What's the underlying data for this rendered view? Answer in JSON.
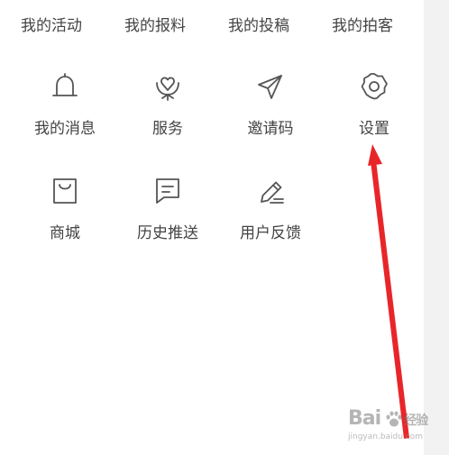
{
  "top_links": [
    {
      "label": "我的活动"
    },
    {
      "label": "我的报料"
    },
    {
      "label": "我的投稿"
    },
    {
      "label": "我的拍客"
    }
  ],
  "grid_items": [
    {
      "label": "我的消息",
      "icon": "bell-icon"
    },
    {
      "label": "服务",
      "icon": "heart-hand-icon"
    },
    {
      "label": "邀请码",
      "icon": "send-icon"
    },
    {
      "label": "设置",
      "icon": "gear-icon"
    },
    {
      "label": "商城",
      "icon": "shopping-bag-icon"
    },
    {
      "label": "历史推送",
      "icon": "message-icon"
    },
    {
      "label": "用户反馈",
      "icon": "pencil-icon"
    }
  ],
  "watermark": {
    "logo_text_1": "Bai",
    "logo_text_2": "经验",
    "url": "jingyan.baidu.com"
  },
  "colors": {
    "text": "#444444",
    "icon_stroke": "#555555",
    "arrow": "#e8262a",
    "background": "#ffffff",
    "side_strip": "#f2f2f2"
  }
}
